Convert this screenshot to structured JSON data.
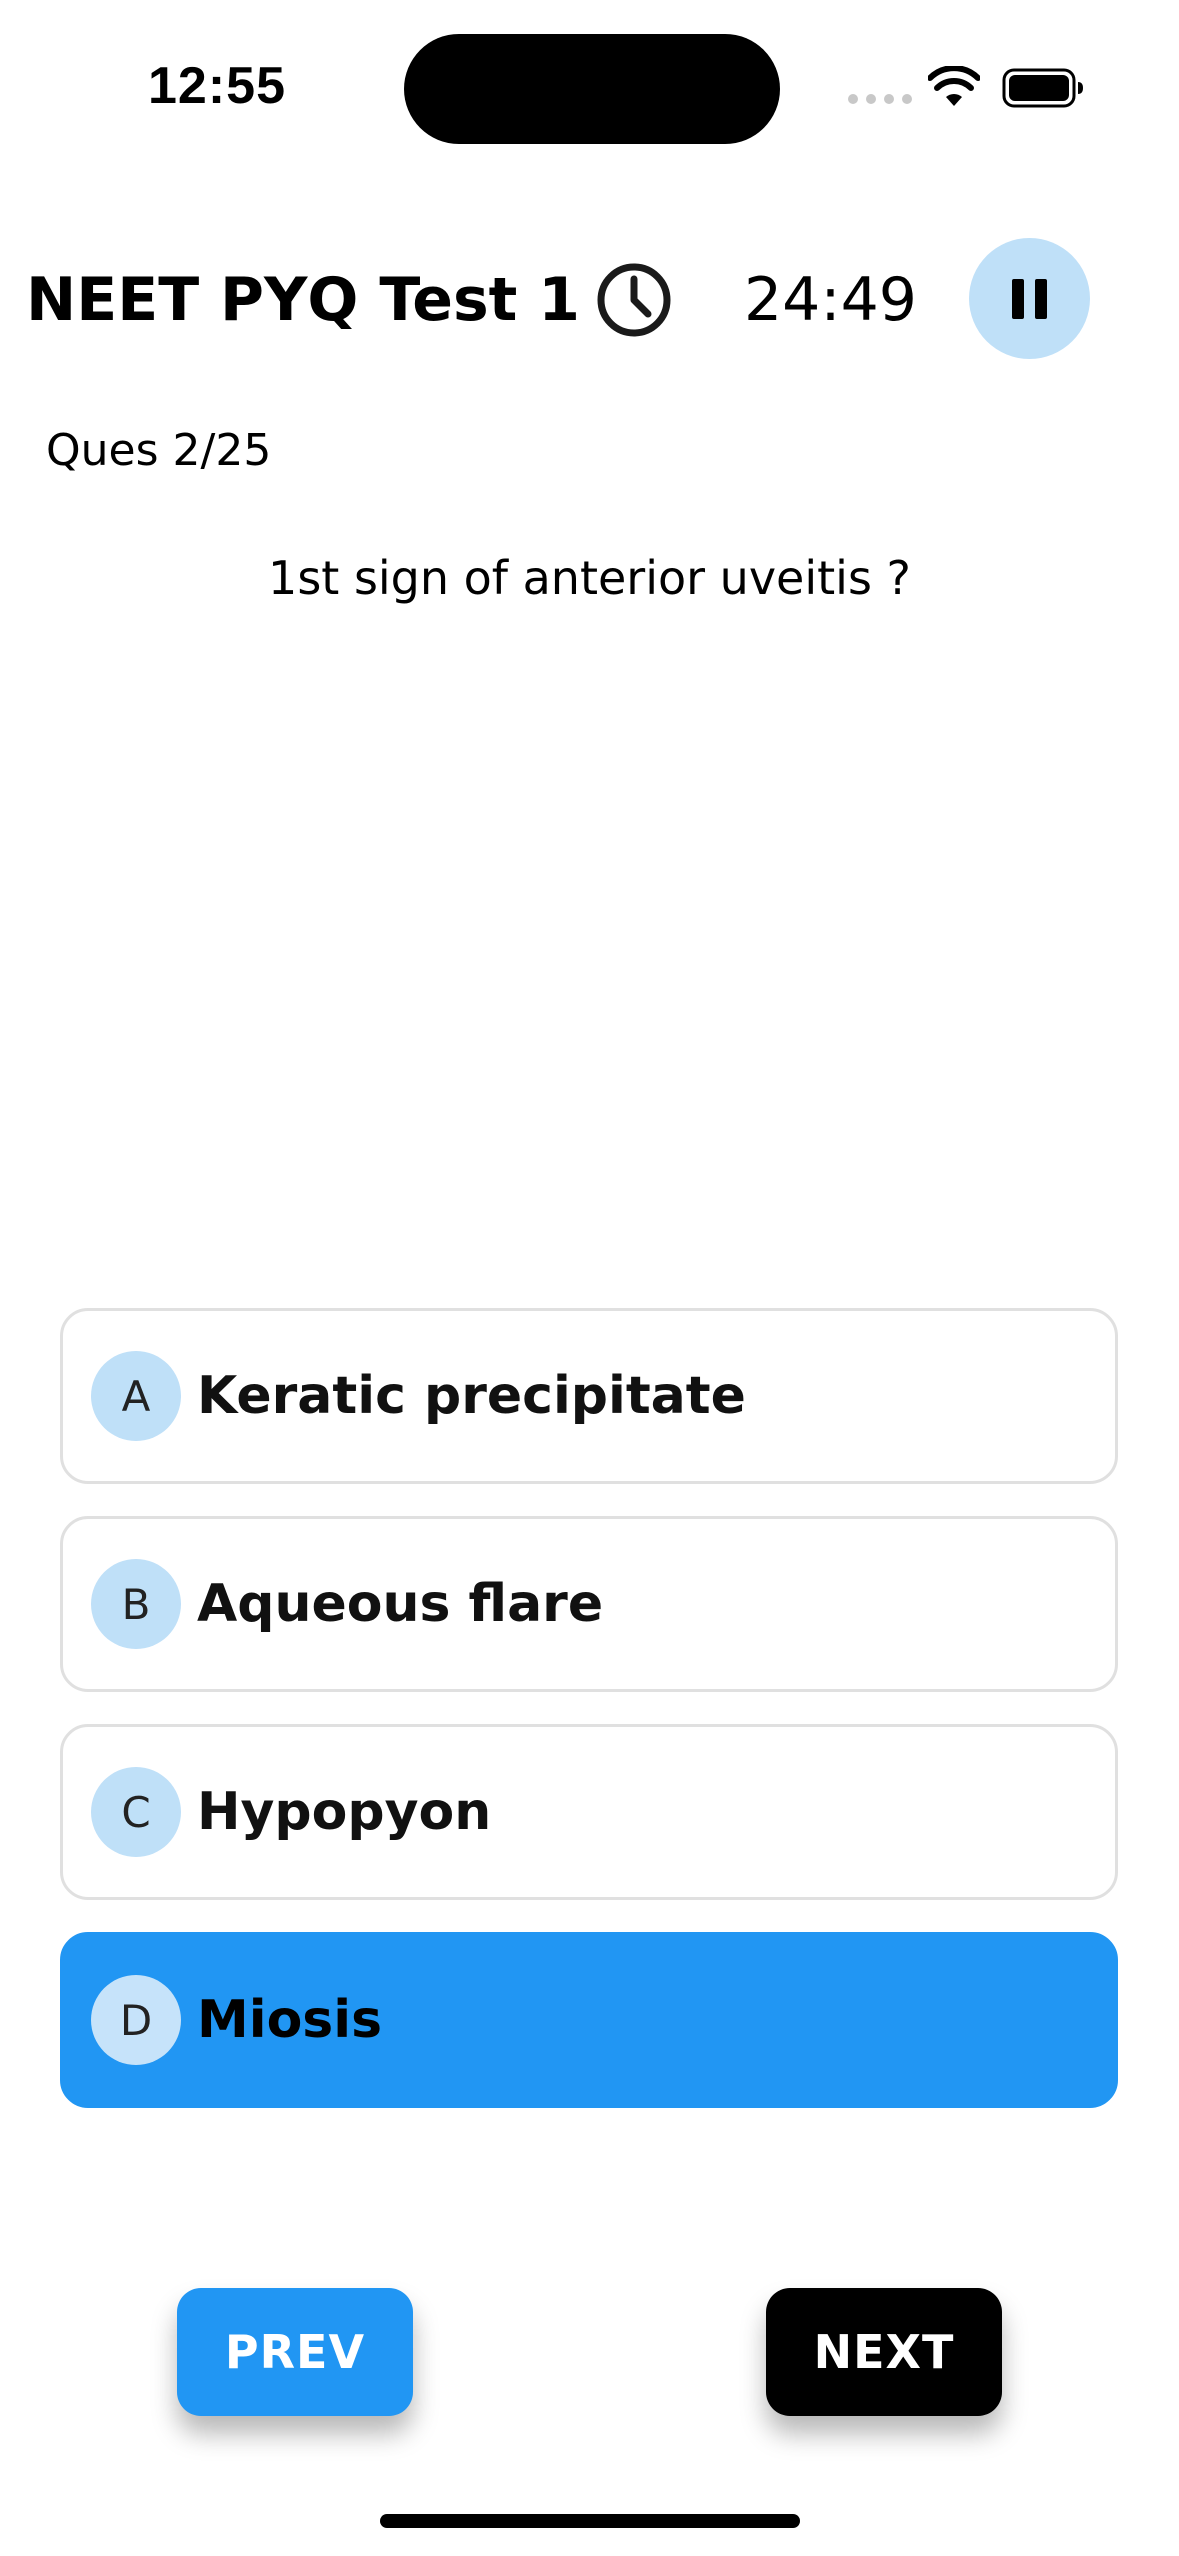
{
  "status_bar": {
    "time": "12:55",
    "icons": [
      "signal-icon",
      "wifi-icon",
      "battery-icon"
    ]
  },
  "header": {
    "title": "NEET PYQ Test 1",
    "timer": "24:49",
    "clock_icon": "clock-icon",
    "pause_icon": "pause-icon"
  },
  "question": {
    "counter": "Ques 2/25",
    "text": "1st sign of anterior uveitis ?"
  },
  "options": [
    {
      "letter": "A",
      "text": "Keratic precipitate",
      "selected": false
    },
    {
      "letter": "B",
      "text": "Aqueous flare",
      "selected": false
    },
    {
      "letter": "C",
      "text": "Hypopyon",
      "selected": false
    },
    {
      "letter": "D",
      "text": "Miosis",
      "selected": true
    }
  ],
  "navigation": {
    "prev_label": "PREV",
    "next_label": "NEXT"
  },
  "colors": {
    "accent": "#2196f3",
    "badge_bg": "#bfe0f8",
    "option_border": "#e0e0e0",
    "next_bg": "#000000"
  }
}
